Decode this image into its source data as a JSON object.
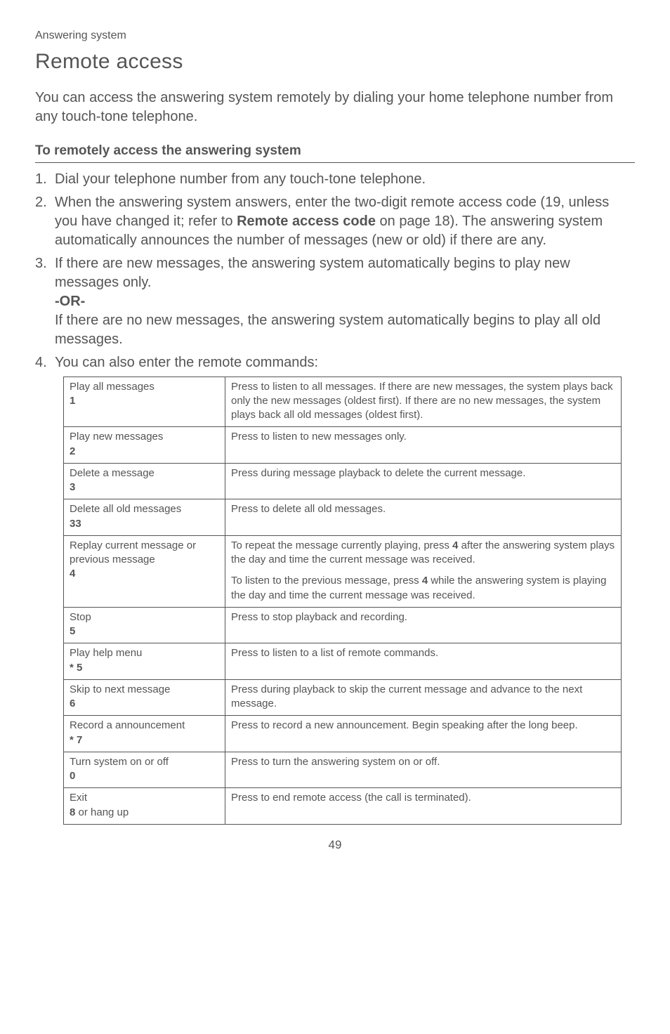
{
  "section_header": "Answering system",
  "page_title": "Remote access",
  "intro": "You can access the answering system remotely by dialing your home telephone number from any touch-tone telephone.",
  "subheading": "To remotely access the answering system",
  "steps": {
    "s1_num": "1.",
    "s1": "Dial your telephone number from any touch-tone telephone.",
    "s2_num": "2.",
    "s2_a": "When the answering system answers, enter the two-digit remote access code (19, unless you have changed it; refer to ",
    "s2_b": "Remote access code",
    "s2_c": " on page 18). The answering system automatically announces the number of messages (new or old) if there are any.",
    "s3_num": "3.",
    "s3_a": "If there are new messages, the answering system automatically begins to play new messages only.",
    "s3_or": "-OR-",
    "s3_b": "If there are no new messages, the answering system automatically begins to play all old messages.",
    "s4_num": "4.",
    "s4": "You can also enter the remote commands:"
  },
  "rows": {
    "r0_name": "Play all messages",
    "r0_key": "1",
    "r0_desc": "Press to listen to all messages. If there are new messages, the system plays back only the new messages (oldest first). If there are no new messages, the system plays back all old messages (oldest first).",
    "r1_name": "Play new messages",
    "r1_key": "2",
    "r1_desc": "Press to listen to new messages only.",
    "r2_name": "Delete a message",
    "r2_key": "3",
    "r2_desc": "Press during message playback to delete the current message.",
    "r3_name": "Delete all old messages",
    "r3_key": "33",
    "r3_desc": "Press to delete all old messages.",
    "r4_name": "Replay current message or previous message",
    "r4_key": "4",
    "r4_desc_a1": "To repeat the message currently playing, press ",
    "r4_desc_a2": "4",
    "r4_desc_a3": " after the answering system plays the day and time the current message was received.",
    "r4_desc_b1": "To listen to the previous message, press ",
    "r4_desc_b2": "4",
    "r4_desc_b3": " while the answering system is playing the day and time the current message was received.",
    "r5_name": "Stop",
    "r5_key": "5",
    "r5_desc": "Press to stop playback and recording.",
    "r6_name": "Play help menu",
    "r6_key": "* 5",
    "r6_desc": "Press to listen to a list of remote commands.",
    "r7_name": "Skip to next message",
    "r7_key": "6",
    "r7_desc": "Press during playback to skip the current message and advance to the next message.",
    "r8_name": "Record a announcement",
    "r8_key": "* 7",
    "r8_desc": "Press to record a new announcement. Begin speaking after the long beep.",
    "r9_name": "Turn system on or off",
    "r9_key": "0",
    "r9_desc": "Press to turn the answering system on or off.",
    "r10_name": "Exit",
    "r10_key_a": "8",
    "r10_key_b": " or hang up",
    "r10_desc": "Press to end remote access (the call is terminated)."
  },
  "page_number": "49"
}
